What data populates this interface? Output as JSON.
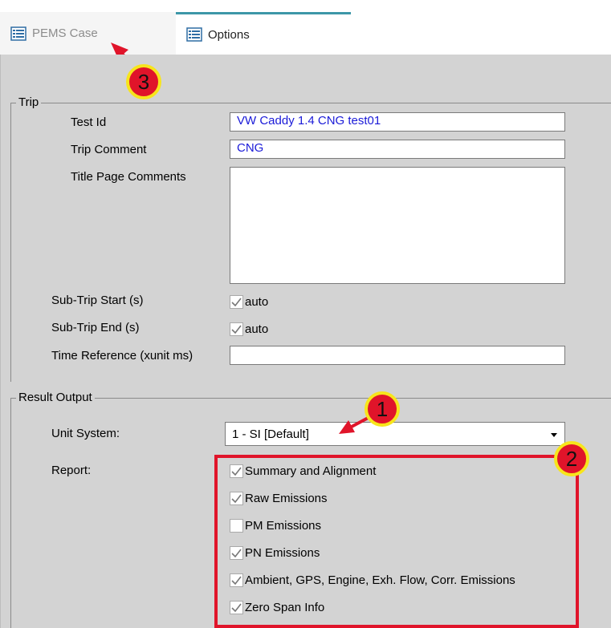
{
  "tabs": [
    {
      "label": "PEMS Case",
      "active": false
    },
    {
      "label": "Options",
      "active": true
    }
  ],
  "trip": {
    "legend": "Trip",
    "test_id_label": "Test Id",
    "test_id_value": "VW Caddy 1.4 CNG test01",
    "trip_comment_label": "Trip Comment",
    "trip_comment_value": "CNG",
    "title_page_comments_label": "Title Page Comments",
    "title_page_comments_value": "",
    "sub_trip_start_label": "Sub-Trip Start (s)",
    "sub_trip_start_auto": "auto",
    "sub_trip_end_label": "Sub-Trip End (s)",
    "sub_trip_end_auto": "auto",
    "time_reference_label": "Time Reference (xunit ms)",
    "time_reference_value": ""
  },
  "result_output": {
    "legend": "Result Output",
    "unit_system_label": "Unit System:",
    "unit_system_value": "1 - SI [Default]",
    "report_label": "Report:",
    "report_items": [
      {
        "label": "Summary and Alignment",
        "checked": true
      },
      {
        "label": "Raw Emissions",
        "checked": true
      },
      {
        "label": "PM Emissions",
        "checked": false
      },
      {
        "label": "PN Emissions",
        "checked": true
      },
      {
        "label": "Ambient, GPS, Engine, Exh. Flow, Corr. Emissions",
        "checked": true
      },
      {
        "label": "Zero Span Info",
        "checked": true
      }
    ]
  },
  "annotations": {
    "badge_1": "1",
    "badge_2": "2",
    "badge_3": "3"
  },
  "colors": {
    "accent_tab": "#3d97a8",
    "annotation_red": "#e0142a",
    "annotation_yellow": "#f7e51c",
    "input_text": "#1a1ad8"
  }
}
